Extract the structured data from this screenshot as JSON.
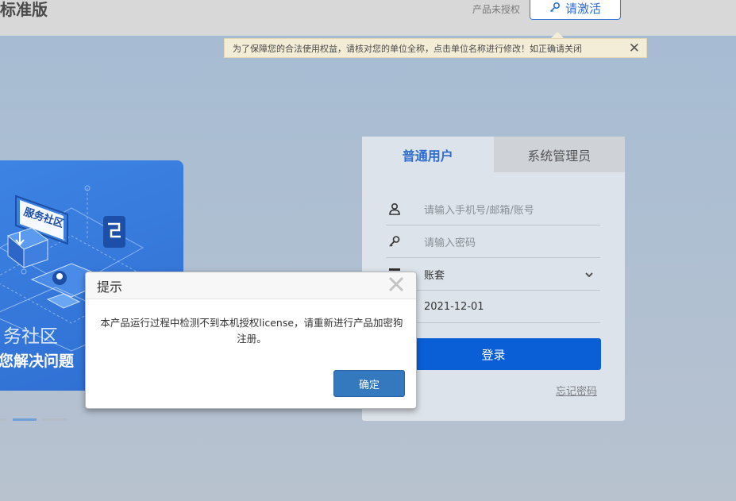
{
  "header": {
    "brand": "标准版",
    "unlicensed_label": "产品未授权",
    "activate_label": "请激活"
  },
  "notice": {
    "text": "为了保障您的合法使用权益，请核对您的单位全称，点击单位名称进行修改！如正确请关闭",
    "close_label": "✕"
  },
  "banner": {
    "badge_text": "服务社区",
    "title": "务社区",
    "subtitle": "您解决问题"
  },
  "login": {
    "tabs": [
      {
        "label": "普通用户",
        "active": true
      },
      {
        "label": "系统管理员",
        "active": false
      }
    ],
    "username_placeholder": "请输入手机号/邮箱/账号",
    "password_placeholder": "请输入密码",
    "account_set_label": "账套",
    "date_value": "2021-12-01",
    "login_button": "登录",
    "forgot_password": "忘记密码"
  },
  "dialog": {
    "title": "提示",
    "message": "本产品运行过程中检测不到本机授权license，请重新进行产品加密狗注册。",
    "ok_button": "确定"
  },
  "colors": {
    "accent": "#0a5fd6",
    "dialog_button": "#3478bd",
    "banner": "#3d84e4"
  }
}
